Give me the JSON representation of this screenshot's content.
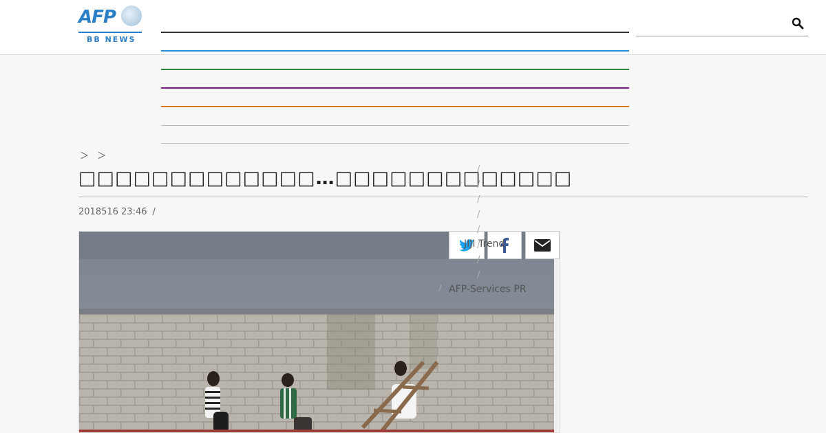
{
  "brand": {
    "logo_text": "AFP",
    "logo_sub": "BB NEWS",
    "accent_color": "#2b7fc7"
  },
  "nav": {
    "line_colors": [
      "#333333",
      "#2b8ccf",
      "#2e8540",
      "#7a1a8a",
      "#d77a1a",
      "#bbbbbb",
      "#bbbbbb"
    ]
  },
  "search": {
    "icon": "search-icon"
  },
  "breadcrumb": {
    "text": "＞ ＞"
  },
  "article": {
    "title": "□□□□□□□□□□□□□…□□□□□□□□□□□□□",
    "date": "2018516 23:46",
    "date_sep": "/"
  },
  "share": {
    "twitter": "twitter-icon",
    "facebook": "facebook-icon",
    "email": "email-icon"
  },
  "sidebar": {
    "slashes": [
      "/",
      "/",
      "/",
      "/",
      "/",
      "/",
      "/",
      "/"
    ],
    "jiji_label": "JIJI Trend",
    "pr_slash": "/",
    "pr_label": "AFP-Services PR"
  }
}
